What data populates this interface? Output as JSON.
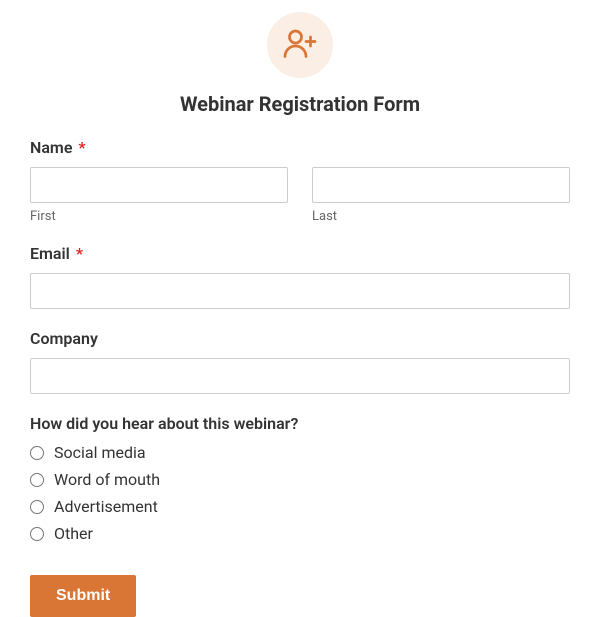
{
  "header": {
    "title": "Webinar Registration Form",
    "icon": "user-plus-icon"
  },
  "fields": {
    "name": {
      "label": "Name",
      "required_mark": "*",
      "first_sublabel": "First",
      "last_sublabel": "Last",
      "first_value": "",
      "last_value": ""
    },
    "email": {
      "label": "Email",
      "required_mark": "*",
      "value": ""
    },
    "company": {
      "label": "Company",
      "value": ""
    },
    "referral": {
      "label": "How did you hear about this webinar?",
      "options": [
        "Social media",
        "Word of mouth",
        "Advertisement",
        "Other"
      ]
    }
  },
  "submit_label": "Submit"
}
